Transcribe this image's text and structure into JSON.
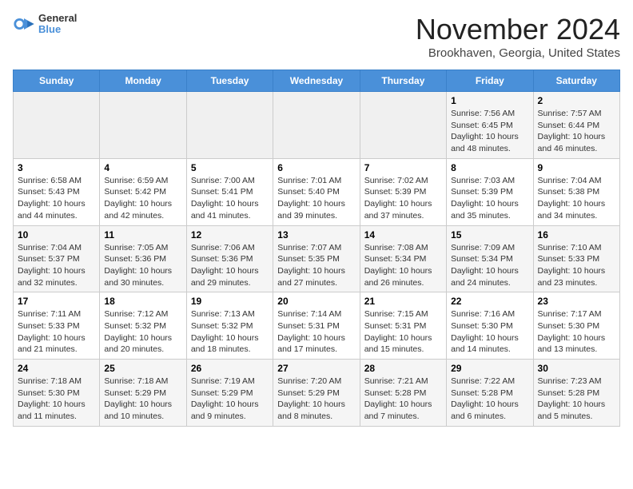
{
  "logo": {
    "line1": "General",
    "line2": "Blue"
  },
  "title": "November 2024",
  "subtitle": "Brookhaven, Georgia, United States",
  "days_of_week": [
    "Sunday",
    "Monday",
    "Tuesday",
    "Wednesday",
    "Thursday",
    "Friday",
    "Saturday"
  ],
  "weeks": [
    [
      {
        "day": "",
        "info": ""
      },
      {
        "day": "",
        "info": ""
      },
      {
        "day": "",
        "info": ""
      },
      {
        "day": "",
        "info": ""
      },
      {
        "day": "",
        "info": ""
      },
      {
        "day": "1",
        "info": "Sunrise: 7:56 AM\nSunset: 6:45 PM\nDaylight: 10 hours and 48 minutes."
      },
      {
        "day": "2",
        "info": "Sunrise: 7:57 AM\nSunset: 6:44 PM\nDaylight: 10 hours and 46 minutes."
      }
    ],
    [
      {
        "day": "3",
        "info": "Sunrise: 6:58 AM\nSunset: 5:43 PM\nDaylight: 10 hours and 44 minutes."
      },
      {
        "day": "4",
        "info": "Sunrise: 6:59 AM\nSunset: 5:42 PM\nDaylight: 10 hours and 42 minutes."
      },
      {
        "day": "5",
        "info": "Sunrise: 7:00 AM\nSunset: 5:41 PM\nDaylight: 10 hours and 41 minutes."
      },
      {
        "day": "6",
        "info": "Sunrise: 7:01 AM\nSunset: 5:40 PM\nDaylight: 10 hours and 39 minutes."
      },
      {
        "day": "7",
        "info": "Sunrise: 7:02 AM\nSunset: 5:39 PM\nDaylight: 10 hours and 37 minutes."
      },
      {
        "day": "8",
        "info": "Sunrise: 7:03 AM\nSunset: 5:39 PM\nDaylight: 10 hours and 35 minutes."
      },
      {
        "day": "9",
        "info": "Sunrise: 7:04 AM\nSunset: 5:38 PM\nDaylight: 10 hours and 34 minutes."
      }
    ],
    [
      {
        "day": "10",
        "info": "Sunrise: 7:04 AM\nSunset: 5:37 PM\nDaylight: 10 hours and 32 minutes."
      },
      {
        "day": "11",
        "info": "Sunrise: 7:05 AM\nSunset: 5:36 PM\nDaylight: 10 hours and 30 minutes."
      },
      {
        "day": "12",
        "info": "Sunrise: 7:06 AM\nSunset: 5:36 PM\nDaylight: 10 hours and 29 minutes."
      },
      {
        "day": "13",
        "info": "Sunrise: 7:07 AM\nSunset: 5:35 PM\nDaylight: 10 hours and 27 minutes."
      },
      {
        "day": "14",
        "info": "Sunrise: 7:08 AM\nSunset: 5:34 PM\nDaylight: 10 hours and 26 minutes."
      },
      {
        "day": "15",
        "info": "Sunrise: 7:09 AM\nSunset: 5:34 PM\nDaylight: 10 hours and 24 minutes."
      },
      {
        "day": "16",
        "info": "Sunrise: 7:10 AM\nSunset: 5:33 PM\nDaylight: 10 hours and 23 minutes."
      }
    ],
    [
      {
        "day": "17",
        "info": "Sunrise: 7:11 AM\nSunset: 5:33 PM\nDaylight: 10 hours and 21 minutes."
      },
      {
        "day": "18",
        "info": "Sunrise: 7:12 AM\nSunset: 5:32 PM\nDaylight: 10 hours and 20 minutes."
      },
      {
        "day": "19",
        "info": "Sunrise: 7:13 AM\nSunset: 5:32 PM\nDaylight: 10 hours and 18 minutes."
      },
      {
        "day": "20",
        "info": "Sunrise: 7:14 AM\nSunset: 5:31 PM\nDaylight: 10 hours and 17 minutes."
      },
      {
        "day": "21",
        "info": "Sunrise: 7:15 AM\nSunset: 5:31 PM\nDaylight: 10 hours and 15 minutes."
      },
      {
        "day": "22",
        "info": "Sunrise: 7:16 AM\nSunset: 5:30 PM\nDaylight: 10 hours and 14 minutes."
      },
      {
        "day": "23",
        "info": "Sunrise: 7:17 AM\nSunset: 5:30 PM\nDaylight: 10 hours and 13 minutes."
      }
    ],
    [
      {
        "day": "24",
        "info": "Sunrise: 7:18 AM\nSunset: 5:30 PM\nDaylight: 10 hours and 11 minutes."
      },
      {
        "day": "25",
        "info": "Sunrise: 7:18 AM\nSunset: 5:29 PM\nDaylight: 10 hours and 10 minutes."
      },
      {
        "day": "26",
        "info": "Sunrise: 7:19 AM\nSunset: 5:29 PM\nDaylight: 10 hours and 9 minutes."
      },
      {
        "day": "27",
        "info": "Sunrise: 7:20 AM\nSunset: 5:29 PM\nDaylight: 10 hours and 8 minutes."
      },
      {
        "day": "28",
        "info": "Sunrise: 7:21 AM\nSunset: 5:28 PM\nDaylight: 10 hours and 7 minutes."
      },
      {
        "day": "29",
        "info": "Sunrise: 7:22 AM\nSunset: 5:28 PM\nDaylight: 10 hours and 6 minutes."
      },
      {
        "day": "30",
        "info": "Sunrise: 7:23 AM\nSunset: 5:28 PM\nDaylight: 10 hours and 5 minutes."
      }
    ]
  ]
}
